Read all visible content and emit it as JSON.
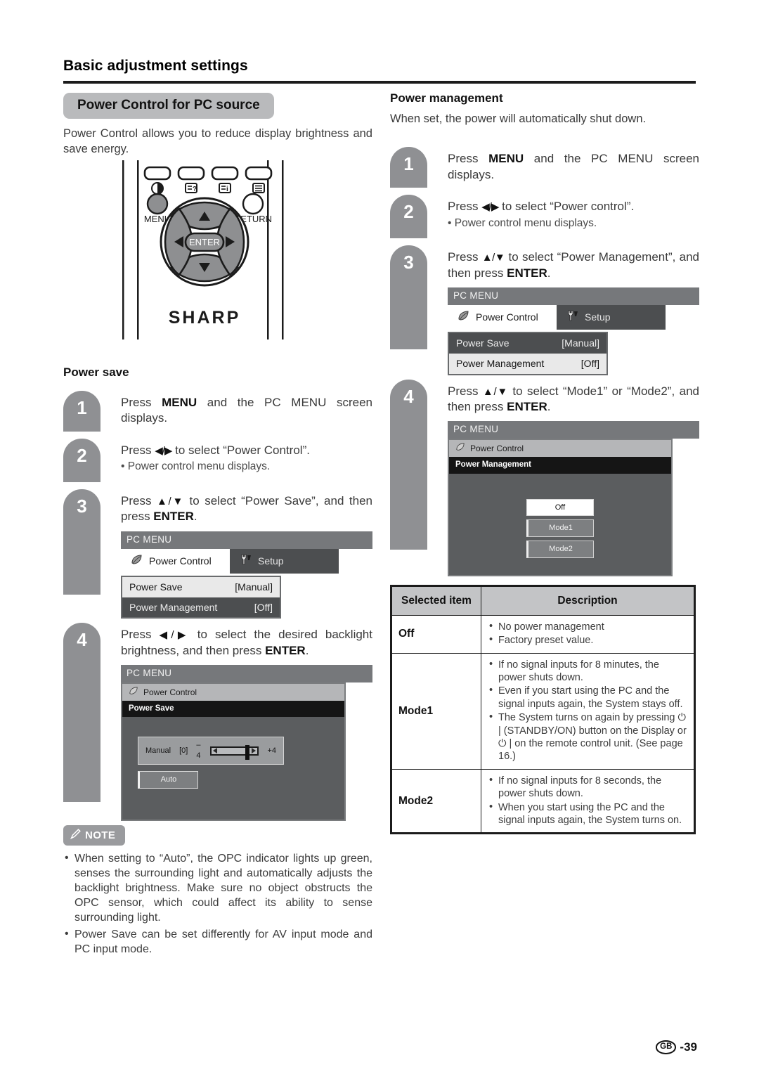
{
  "page": {
    "title": "Basic adjustment settings",
    "footer_locale": "GB",
    "footer_page": "-39"
  },
  "left": {
    "section_pill": "Power Control for PC source",
    "intro": "Power Control allows you to reduce display brightness and save energy.",
    "remote": {
      "menu_label": "MENU",
      "return_label": "RETURN",
      "enter_label": "ENTER",
      "brand": "SHARP"
    },
    "subhead": "Power save",
    "steps": [
      {
        "num": "1",
        "text_parts": [
          "Press ",
          "MENU",
          " and the PC MENU screen displays."
        ]
      },
      {
        "num": "2",
        "text_parts": [
          "Press ",
          "◀/▶",
          " to select “Power Control”."
        ],
        "bullet": "• Power control menu displays."
      },
      {
        "num": "3",
        "text_parts": [
          "Press ",
          "▲/▼",
          " to select “Power Save”, and then press ",
          "ENTER",
          "."
        ]
      },
      {
        "num": "4",
        "text_parts": [
          "Press ",
          "◀/▶",
          " to select the desired backlight brightness, and then press ",
          "ENTER",
          "."
        ]
      }
    ],
    "osd_menu": {
      "title": "PC MENU",
      "tab_active": "Power Control",
      "tab_idle": "Setup",
      "rows": [
        {
          "label": "Power Save",
          "value": "[Manual]",
          "selected": true
        },
        {
          "label": "Power Management",
          "value": "[Off]",
          "selected": false
        }
      ]
    },
    "osd_powersave": {
      "title": "PC MENU",
      "crumb1": "Power Control",
      "crumb2": "Power Save",
      "slider": {
        "mode_label": "Manual",
        "value": "[0]",
        "min_label": "–4",
        "max_label": "+4"
      },
      "auto_button": "Auto"
    },
    "note": {
      "label": "NOTE",
      "items": [
        "When setting to “Auto”, the OPC indicator lights up green, senses the surrounding light and automatically adjusts the backlight brightness. Make sure no object obstructs the OPC sensor, which could affect its ability to sense surrounding light.",
        "Power Save can be set differently for AV input mode and PC input mode."
      ]
    }
  },
  "right": {
    "subhead": "Power management",
    "intro": "When set, the power will automatically shut down.",
    "steps": [
      {
        "num": "1",
        "text_parts": [
          "Press ",
          "MENU",
          " and the PC MENU screen displays."
        ]
      },
      {
        "num": "2",
        "text_parts": [
          "Press ",
          "◀/▶",
          " to select “Power control”."
        ],
        "bullet": "• Power control menu displays."
      },
      {
        "num": "3",
        "text_parts": [
          "Press ",
          "▲/▼",
          " to select “Power Management”, and then press ",
          "ENTER",
          "."
        ]
      },
      {
        "num": "4",
        "text_parts": [
          "Press ",
          "▲/▼",
          " to select “Mode1” or “Mode2”, and then press ",
          "ENTER",
          "."
        ]
      }
    ],
    "osd_menu": {
      "title": "PC MENU",
      "tab_active": "Power Control",
      "tab_idle": "Setup",
      "rows": [
        {
          "label": "Power Save",
          "value": "[Manual]",
          "selected": false
        },
        {
          "label": "Power Management",
          "value": "[Off]",
          "selected": true
        }
      ]
    },
    "osd_pm": {
      "title": "PC MENU",
      "crumb1": "Power Control",
      "crumb2": "Power Management",
      "options": [
        {
          "label": "Off",
          "selected": true
        },
        {
          "label": "Mode1",
          "selected": false
        },
        {
          "label": "Mode2",
          "selected": false
        }
      ]
    },
    "table": {
      "headers": [
        "Selected item",
        "Description"
      ],
      "rows": [
        {
          "item": "Off",
          "lines": [
            "No power management",
            "Factory preset value."
          ]
        },
        {
          "item": "Mode1",
          "lines": [
            "If no signal inputs for 8 minutes, the power shuts down.",
            "Even if you start using the PC and the signal inputs again, the System stays off.",
            "The System turns on again by pressing ⏻ | (STANDBY/ON) button on the Display or ⏻ | on the remote control unit. (See page 16.)"
          ]
        },
        {
          "item": "Mode2",
          "lines": [
            "If no signal inputs for 8 seconds, the power shuts down.",
            "When you start using the PC and the signal inputs again, the System turns on."
          ]
        }
      ]
    }
  }
}
